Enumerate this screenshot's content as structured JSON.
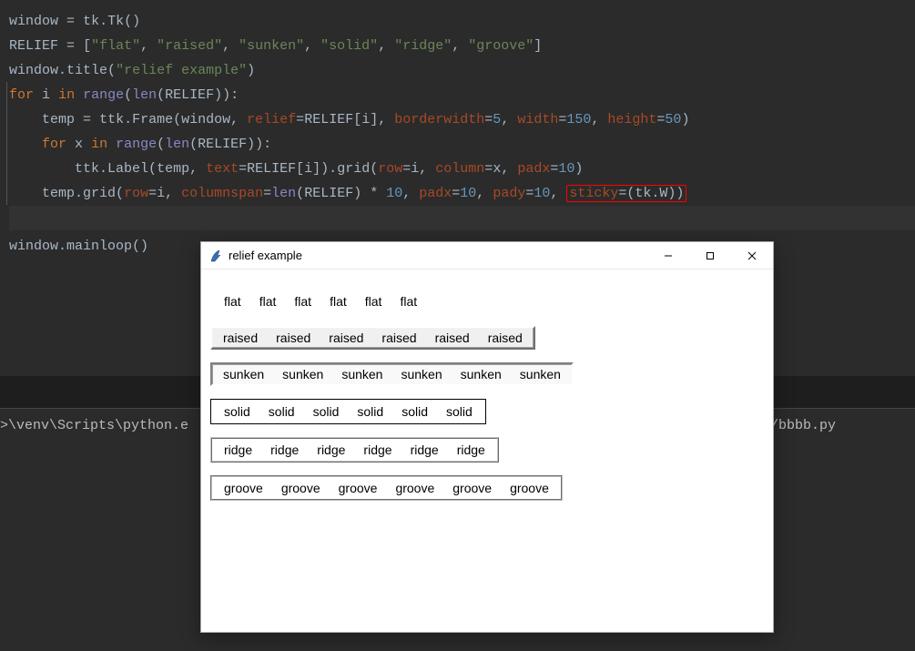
{
  "code": {
    "l1_window": "window",
    "l1_tk": "tk",
    "l1_Tk": "Tk",
    "l2_RELIEF": "RELIEF",
    "l2_vals": [
      "\"flat\"",
      "\"raised\"",
      "\"sunken\"",
      "\"solid\"",
      "\"ridge\"",
      "\"groove\""
    ],
    "l3_title": "\"relief example\"",
    "kw_for": "for",
    "kw_in": "in",
    "var_i": "i",
    "var_x": "x",
    "fn_range": "range",
    "fn_len": "len",
    "var_temp": "temp",
    "ttk": "ttk",
    "Frame": "Frame",
    "Label": "Label",
    "p_relief": "relief",
    "p_borderwidth": "borderwidth",
    "p_width": "width",
    "p_height": "height",
    "p_text": "text",
    "p_row": "row",
    "p_column": "column",
    "p_padx": "padx",
    "p_pady": "pady",
    "p_columnspan": "columnspan",
    "p_sticky": "sticky",
    "n5": "5",
    "n150": "150",
    "n50": "50",
    "n10": "10",
    "tkW": "tk.W",
    "grid": "grid",
    "mainloop": "mainloop",
    "method_title": "title"
  },
  "terminal": {
    "left": ">\\venv\\Scripts\\python.e",
    "right": "y/bbbb.py"
  },
  "tk": {
    "title": "relief example",
    "reliefs": [
      "flat",
      "raised",
      "sunken",
      "solid",
      "ridge",
      "groove"
    ]
  }
}
